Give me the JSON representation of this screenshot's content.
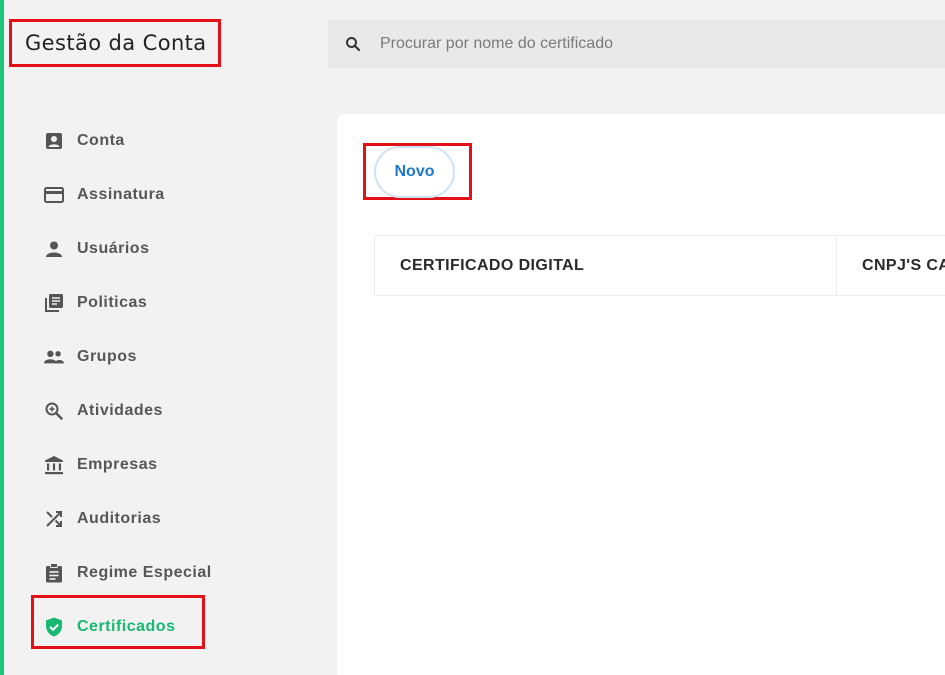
{
  "app": {
    "title": "Gestão da Conta"
  },
  "search": {
    "placeholder": "Procurar por nome do certificado"
  },
  "sidebar": {
    "items": [
      {
        "label": "Conta",
        "icon": "account-box-icon"
      },
      {
        "label": "Assinatura",
        "icon": "credit-card-icon"
      },
      {
        "label": "Usuários",
        "icon": "person-icon"
      },
      {
        "label": "Politicas",
        "icon": "library-books-icon"
      },
      {
        "label": "Grupos",
        "icon": "people-icon"
      },
      {
        "label": "Atividades",
        "icon": "zoom-in-icon"
      },
      {
        "label": "Empresas",
        "icon": "bank-icon"
      },
      {
        "label": "Auditorias",
        "icon": "shuffle-icon"
      },
      {
        "label": "Regime Especial",
        "icon": "clipboard-icon"
      },
      {
        "label": "Certificados",
        "icon": "shield-check-icon",
        "active": true
      }
    ]
  },
  "main": {
    "new_button_label": "Novo",
    "table": {
      "columns": [
        "CERTIFICADO DIGITAL",
        "CNPJ'S CA"
      ]
    }
  },
  "colors": {
    "accent": "#1ec47a",
    "active_text": "#17b86f",
    "primary_button_text": "#1f78c8",
    "highlight_box": "#e41018"
  }
}
